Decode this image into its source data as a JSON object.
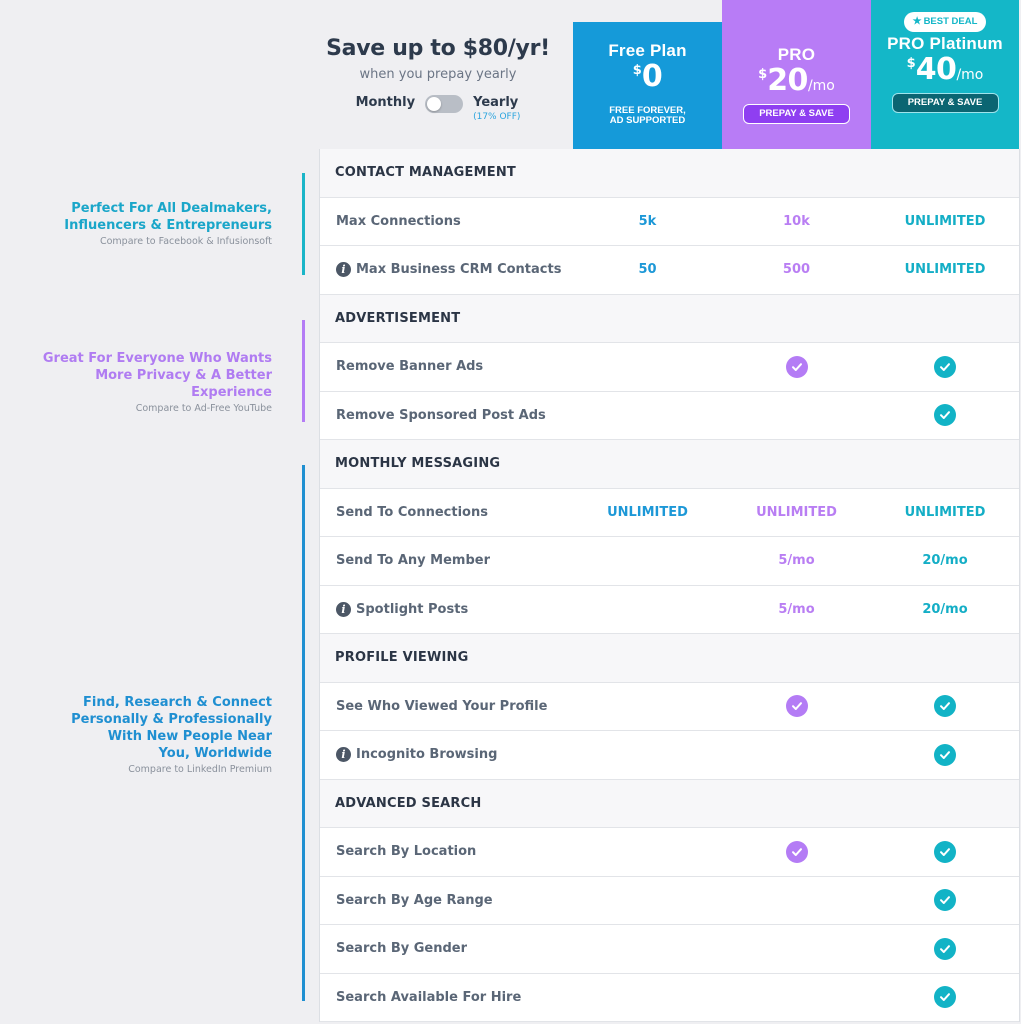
{
  "header": {
    "save_title": "Save up to $80/yr!",
    "save_subtitle": "when you prepay yearly",
    "toggle_monthly": "Monthly",
    "toggle_yearly": "Yearly",
    "toggle_yearly_note": "(17% OFF)"
  },
  "plans": {
    "free": {
      "name": "Free Plan",
      "currency": "$",
      "price": "0",
      "note_line1": "FREE FOREVER,",
      "note_line2": "AD SUPPORTED",
      "color": "#159ad9"
    },
    "pro": {
      "name": "PRO",
      "currency": "$",
      "price": "20",
      "per": "/mo",
      "button": "PREPAY & SAVE",
      "color": "#b87cf6"
    },
    "platinum": {
      "badge": "BEST DEAL",
      "name": "PRO Platinum",
      "currency": "$",
      "price": "40",
      "per": "/mo",
      "button": "PREPAY & SAVE",
      "color": "#14b7c8"
    }
  },
  "side_notes": [
    {
      "title_line1": "Perfect For All Dealmakers,",
      "title_line2": "Influencers & Entrepreneurs",
      "sub": "Compare to Facebook & Infusionsoft"
    },
    {
      "title_line1": "Great For Everyone Who Wants",
      "title_line2": "More Privacy & A Better Experience",
      "sub": "Compare to Ad-Free YouTube"
    },
    {
      "title_line1": "Find, Research & Connect",
      "title_line2": "Personally & Professionally",
      "title_line3": "With New People Near",
      "title_line4": "You, Worldwide",
      "sub": "Compare to LinkedIn Premium"
    }
  ],
  "sections": {
    "contact": {
      "title": "CONTACT MANAGEMENT",
      "rows": [
        {
          "label": "Max Connections",
          "free": "5k",
          "pro": "10k",
          "plat": "UNLIMITED"
        },
        {
          "label": "Max Business CRM Contacts",
          "free": "50",
          "pro": "500",
          "plat": "UNLIMITED"
        }
      ]
    },
    "ads": {
      "title": "ADVERTISEMENT",
      "rows": [
        {
          "label": "Remove Banner Ads"
        },
        {
          "label": "Remove Sponsored Post Ads"
        }
      ]
    },
    "messaging": {
      "title": "MONTHLY MESSAGING",
      "rows": [
        {
          "label": "Send To Connections",
          "free": "UNLIMITED",
          "pro": "UNLIMITED",
          "plat": "UNLIMITED"
        },
        {
          "label": "Send To Any Member",
          "pro": "5/mo",
          "plat": "20/mo"
        },
        {
          "label": "Spotlight Posts",
          "pro": "5/mo",
          "plat": "20/mo"
        }
      ]
    },
    "profile": {
      "title": "PROFILE VIEWING",
      "rows": [
        {
          "label": "See Who Viewed Your Profile"
        },
        {
          "label": "Incognito Browsing"
        }
      ]
    },
    "search": {
      "title": "ADVANCED SEARCH",
      "rows": [
        {
          "label": "Search By Location"
        },
        {
          "label": "Search By Age Range"
        },
        {
          "label": "Search By Gender"
        },
        {
          "label": "Search Available For Hire"
        }
      ]
    }
  }
}
